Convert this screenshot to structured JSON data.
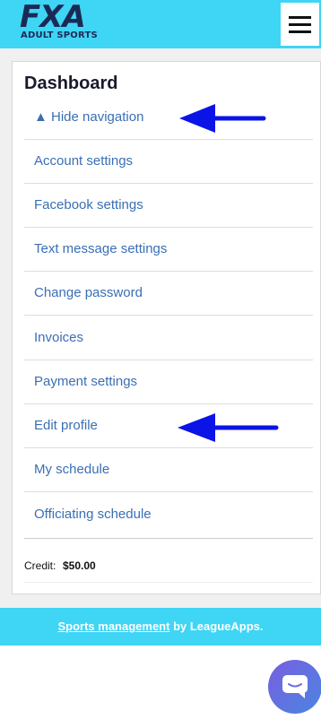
{
  "header": {
    "logo_main": "FXA",
    "logo_sub": "ADULT SPORTS",
    "menu_icon": "hamburger-icon"
  },
  "dashboard": {
    "title": "Dashboard",
    "nav_items": [
      {
        "label": "▲ Hide navigation"
      },
      {
        "label": "Account settings"
      },
      {
        "label": "Facebook settings"
      },
      {
        "label": "Text message settings"
      },
      {
        "label": "Change password"
      },
      {
        "label": "Invoices"
      },
      {
        "label": "Payment settings"
      },
      {
        "label": "Edit profile"
      },
      {
        "label": "My schedule"
      },
      {
        "label": "Officiating schedule"
      }
    ],
    "credit_label": "Credit:",
    "credit_value": "$50.00"
  },
  "footer": {
    "link_text": "Sports management",
    "suffix": " by LeagueApps."
  },
  "colors": {
    "accent": "#3fd5f5",
    "link": "#3a6fb4",
    "annotation_arrow": "#0a14e6"
  },
  "chat_widget": {
    "icon": "chat-bubble-icon"
  }
}
